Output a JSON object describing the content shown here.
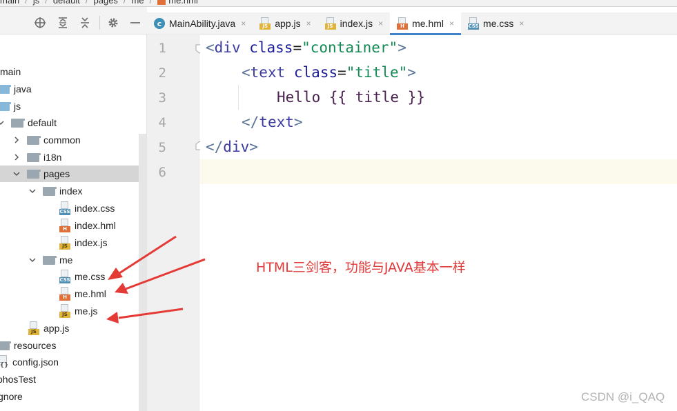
{
  "breadcrumb": {
    "parts": [
      "main",
      "js",
      "default",
      "pages",
      "me"
    ],
    "file": "me.hml"
  },
  "sidebar": {
    "toolbar_icons": [
      "locate-icon",
      "expand-all-icon",
      "collapse-all-icon",
      "gear-icon",
      "hide-icon"
    ],
    "items": [
      {
        "label": "main"
      },
      {
        "label": "java"
      },
      {
        "label": "js"
      },
      {
        "label": "default"
      },
      {
        "label": "common"
      },
      {
        "label": "i18n"
      },
      {
        "label": "pages"
      },
      {
        "label": "index"
      },
      {
        "label": "index.css"
      },
      {
        "label": "index.hml"
      },
      {
        "label": "index.js"
      },
      {
        "label": "me"
      },
      {
        "label": "me.css"
      },
      {
        "label": "me.hml"
      },
      {
        "label": "me.js"
      },
      {
        "label": "app.js"
      },
      {
        "label": "resources"
      },
      {
        "label": "config.json"
      },
      {
        "label": "ohosTest"
      },
      {
        "label": "gnore"
      }
    ],
    "file_badges": {
      "css": "CSS",
      "hml": "H",
      "js": "JS",
      "json": "{}"
    }
  },
  "tabs": [
    {
      "label": "MainAbility.java",
      "icon": "class-icon",
      "active": false
    },
    {
      "label": "app.js",
      "icon": "js-file-icon",
      "active": false
    },
    {
      "label": "index.js",
      "icon": "js-file-icon",
      "active": false
    },
    {
      "label": "me.hml",
      "icon": "hml-file-icon",
      "active": true
    },
    {
      "label": "me.css",
      "icon": "css-file-icon",
      "active": false
    }
  ],
  "tab_close_glyph": "×",
  "editor": {
    "line_numbers": [
      "1",
      "2",
      "3",
      "4",
      "5",
      "6"
    ],
    "lines": [
      {
        "open": "<",
        "name": "div",
        "sp": " ",
        "attr": "class",
        "eq": "=",
        "val": "\"container\"",
        "close": ">"
      },
      {
        "open": "<",
        "name": "text",
        "sp": " ",
        "attr": "class",
        "eq": "=",
        "val": "\"title\"",
        "close": ">"
      },
      {
        "text": "Hello {{ title }}"
      },
      {
        "open": "</",
        "name": "text",
        "close": ">"
      },
      {
        "open": "</",
        "name": "div",
        "close": ">"
      },
      {}
    ]
  },
  "annotation": {
    "text": "HTML三剑客，功能与JAVA基本一样",
    "color": "#e03a3a"
  },
  "watermark": "CSDN @i_QAQ"
}
